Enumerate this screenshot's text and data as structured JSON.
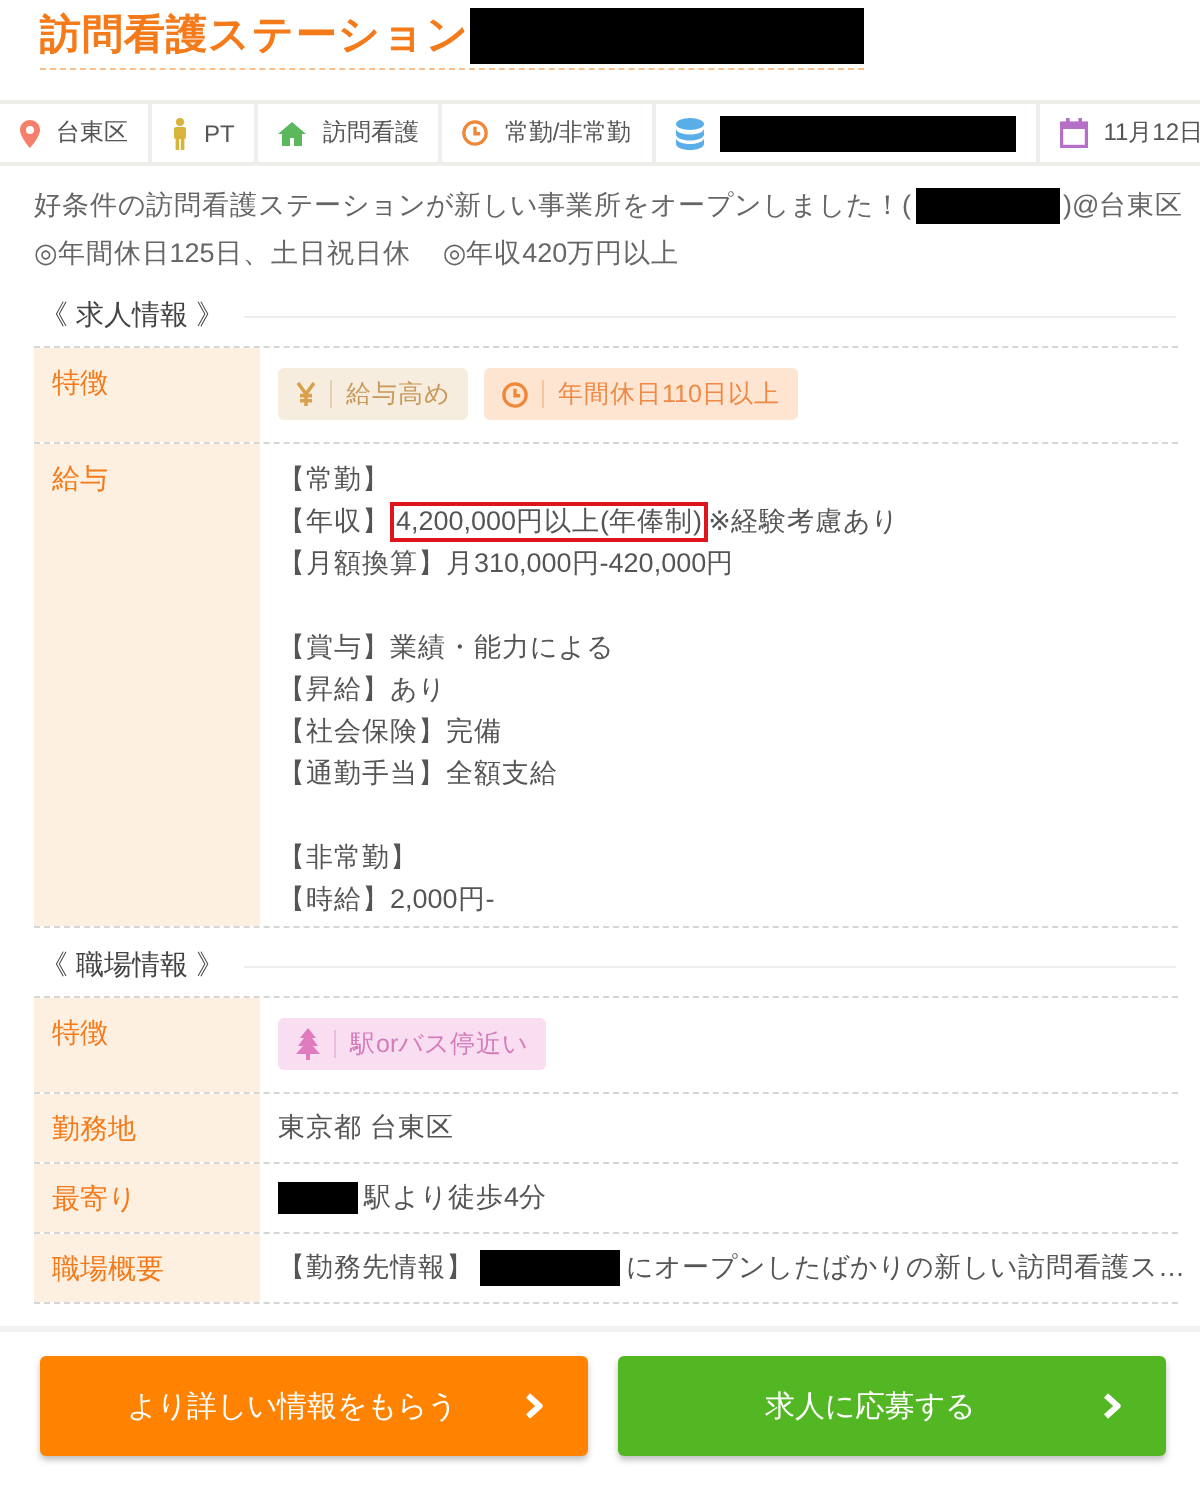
{
  "title": {
    "parts": [
      {
        "kind": "text",
        "text": "訪問看護ステーション"
      },
      {
        "kind": "redacted"
      }
    ]
  },
  "meta": [
    {
      "kind": "location",
      "label": "台東区",
      "redacted": false
    },
    {
      "kind": "job",
      "label": "PT",
      "redacted": false
    },
    {
      "kind": "category",
      "label": "訪問看護",
      "redacted": false
    },
    {
      "kind": "employment",
      "label": "常勤/非常勤",
      "redacted": false
    },
    {
      "kind": "company",
      "redacted": true
    },
    {
      "kind": "date",
      "label": "11月12日",
      "redacted": false
    }
  ],
  "intro": {
    "parts": [
      {
        "kind": "text",
        "text": "好条件の訪問看護ステーションが新しい事業所をオープンしました！("
      },
      {
        "kind": "redacted"
      },
      {
        "kind": "text",
        "text": ")@台東区"
      }
    ],
    "highlights": [
      "◎年間休日125日、土日祝日休",
      "◎年収420万円以上"
    ]
  },
  "sections": [
    {
      "heading": "《 求人情報 》",
      "rows": [
        {
          "label": "特徴",
          "kind": "tags",
          "tags": [
            {
              "kind": "salary",
              "label": "給与高め"
            },
            {
              "kind": "holiday",
              "label": "年間休日110日以上"
            }
          ]
        },
        {
          "label": "給与",
          "kind": "lines",
          "blocks": [
            [
              [
                {
                  "text": "【常勤】",
                  "highlighted": false
                }
              ],
              [
                {
                  "text": "【年収】",
                  "highlighted": false
                },
                {
                  "text": "4,200,000円以上(年俸制)",
                  "highlighted": true
                },
                {
                  "text": "※経験考慮あり",
                  "highlighted": false
                }
              ],
              [
                {
                  "text": "【月額換算】月310,000円-420,000円",
                  "highlighted": false
                }
              ]
            ],
            [
              [
                {
                  "text": "【賞与】業績・能力による",
                  "highlighted": false
                }
              ],
              [
                {
                  "text": "【昇給】あり",
                  "highlighted": false
                }
              ],
              [
                {
                  "text": "【社会保険】完備",
                  "highlighted": false
                }
              ],
              [
                {
                  "text": "【通勤手当】全額支給",
                  "highlighted": false
                }
              ]
            ],
            [
              [
                {
                  "text": "【非常勤】",
                  "highlighted": false
                }
              ],
              [
                {
                  "text": "【時給】2,000円-",
                  "highlighted": false
                }
              ]
            ]
          ]
        }
      ]
    },
    {
      "heading": "《 職場情報 》",
      "rows": [
        {
          "label": "特徴",
          "kind": "tags",
          "tags": [
            {
              "kind": "access",
              "label": "駅orバス停近い"
            }
          ]
        },
        {
          "label": "勤務地",
          "kind": "text",
          "value": "東京都 台東区"
        },
        {
          "label": "最寄り",
          "kind": "parts",
          "parts": [
            {
              "kind": "redacted"
            },
            {
              "kind": "text",
              "text": "駅より徒歩4分"
            }
          ]
        },
        {
          "label": "職場概要",
          "kind": "parts",
          "parts": [
            {
              "kind": "text",
              "text": "【勤務先情報】"
            },
            {
              "kind": "redacted"
            },
            {
              "kind": "text",
              "text": "にオープンしたばかりの新しい訪問看護ス…"
            }
          ]
        }
      ]
    }
  ],
  "buttons": [
    {
      "kind": "inquiry",
      "label": "より詳しい情報をもらう"
    },
    {
      "kind": "apply",
      "label": "求人に応募する"
    }
  ]
}
